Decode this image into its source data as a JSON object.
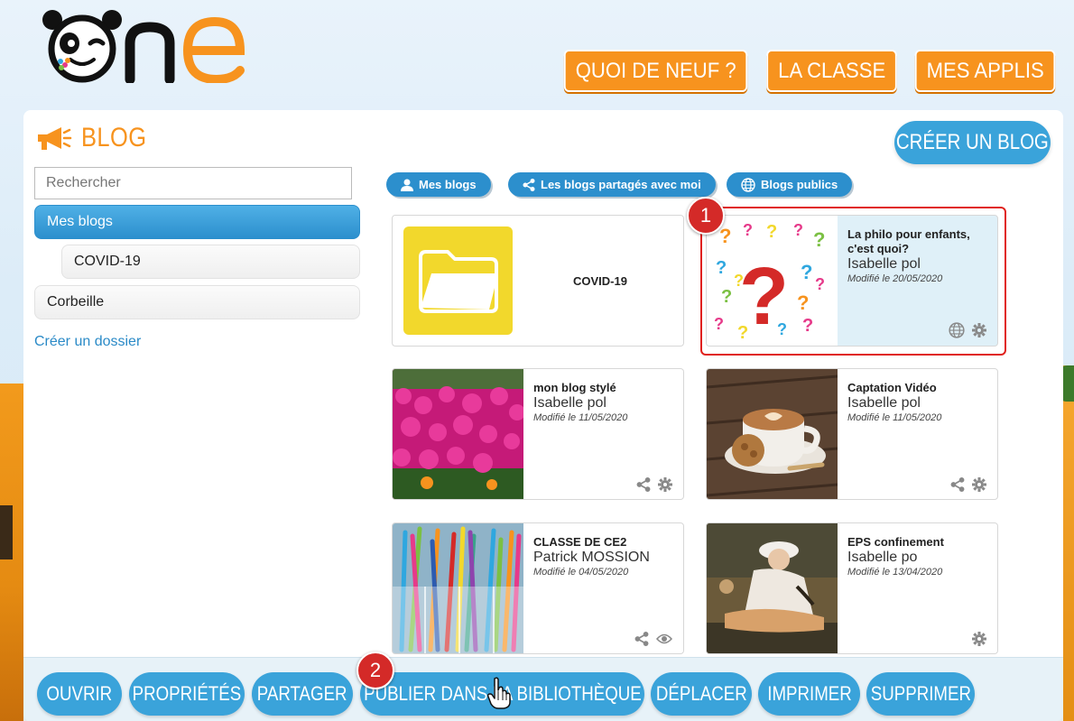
{
  "app": {
    "logo_text": "One"
  },
  "topnav": [
    {
      "label": "QUOI DE NEUF ?"
    },
    {
      "label": "LA CLASSE"
    },
    {
      "label": "MES APPLIS"
    }
  ],
  "header": {
    "title": "BLOG",
    "create_label": "CRÉER UN BLOG"
  },
  "sidebar": {
    "search_placeholder": "Rechercher",
    "items": [
      {
        "label": "Mes blogs"
      },
      {
        "label": "COVID-19"
      },
      {
        "label": "Corbeille"
      }
    ],
    "create_folder": "Créer un dossier"
  },
  "filters": [
    {
      "label": "Mes blogs",
      "icon": "user-icon"
    },
    {
      "label": "Les blogs partagés avec moi",
      "icon": "share-icon"
    },
    {
      "label": "Blogs publics",
      "icon": "globe-icon"
    }
  ],
  "folder": {
    "label": "COVID-19"
  },
  "cards": [
    {
      "title": "La philo pour enfants, c'est quoi?",
      "author": "Isabelle pol",
      "date": "Modifié le 20/05/2020",
      "actions": [
        "globe-icon",
        "gear-icon"
      ]
    },
    {
      "title": "mon blog stylé",
      "author": "Isabelle pol",
      "date": "Modifié le 11/05/2020",
      "actions": [
        "share-icon",
        "gear-icon"
      ]
    },
    {
      "title": "Captation Vidéo",
      "author": "Isabelle pol",
      "date": "Modifié le 11/05/2020",
      "actions": [
        "share-icon",
        "gear-icon"
      ]
    },
    {
      "title": "CLASSE DE CE2",
      "author": "Patrick MOSSION",
      "date": "Modifié le 04/05/2020",
      "actions": [
        "share-icon",
        "eye-icon"
      ]
    },
    {
      "title": "EPS confinement",
      "author": "Isabelle po",
      "date": "Modifié le 13/04/2020",
      "actions": [
        "gear-icon"
      ]
    }
  ],
  "steps": [
    "1",
    "2"
  ],
  "toolbar": [
    {
      "label": "OUVRIR"
    },
    {
      "label": "PROPRIÉTÉS"
    },
    {
      "label": "PARTAGER"
    },
    {
      "label": "PUBLIER DANS LA BIBLIOTHÈQUE"
    },
    {
      "label": "DÉPLACER"
    },
    {
      "label": "IMPRIMER"
    },
    {
      "label": "SUPPRIMER"
    }
  ],
  "colors": {
    "orange": "#f7931e",
    "blue": "#3aa3da",
    "dark_blue": "#2c8fcd",
    "highlight_red": "#e0201b"
  }
}
